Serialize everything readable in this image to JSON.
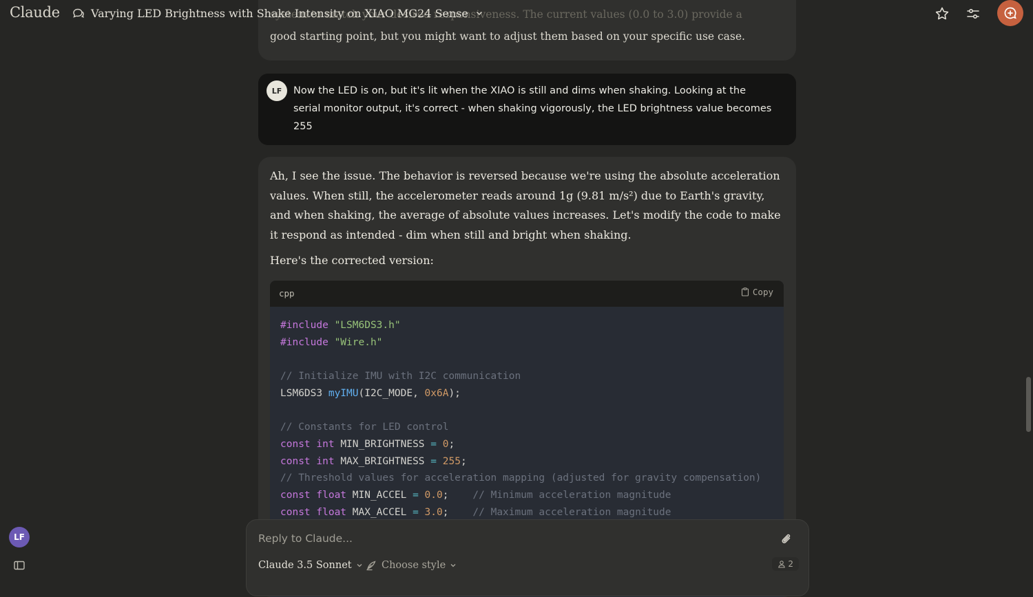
{
  "app": {
    "name": "Claude"
  },
  "header": {
    "conversation_title": "Varying LED Brightness with Shake Intensity on XIAO MG24 Sense",
    "icons": [
      "chat-bubble-icon",
      "chevron-down-icon",
      "star-icon",
      "sliders-icon",
      "new-chat-icon"
    ],
    "accent_color": "#c6613f"
  },
  "previous_message": {
    "faded_line": "system to match your desired responsiveness. The current values (0.0 to 3.0) provide a",
    "last_line": "good starting point, but you might want to adjust them based on your specific use case."
  },
  "user_message": {
    "avatar_initials": "LF",
    "text": "Now the LED is on, but it's lit when the XIAO is still and dims when shaking. Looking at the serial monitor output, it's correct - when shaking vigorously, the LED brightness value becomes 255"
  },
  "assistant_message": {
    "paragraph_1": "Ah, I see the issue. The behavior is reversed because we're using the absolute acceleration values. When still, the accelerometer reads around 1g (9.81 m/s²) due to Earth's gravity, and when shaking, the average of absolute values increases. Let's modify the code to make it respond as intended - dim when still and bright when shaking.",
    "paragraph_2": "Here's the corrected version:",
    "code_block": {
      "language": "cpp",
      "copy_label": "Copy",
      "lines": [
        [
          {
            "t": "kw",
            "v": "#include "
          },
          {
            "t": "str",
            "v": "\"LSM6DS3.h\""
          }
        ],
        [
          {
            "t": "kw",
            "v": "#include "
          },
          {
            "t": "str",
            "v": "\"Wire.h\""
          }
        ],
        [],
        [
          {
            "t": "com",
            "v": "// Initialize IMU with I2C communication"
          }
        ],
        [
          {
            "t": "plain",
            "v": "LSM6DS3 "
          },
          {
            "t": "fn",
            "v": "myIMU"
          },
          {
            "t": "plain",
            "v": "(I2C_MODE, "
          },
          {
            "t": "num",
            "v": "0x6A"
          },
          {
            "t": "plain",
            "v": ");"
          }
        ],
        [],
        [
          {
            "t": "com",
            "v": "// Constants for LED control"
          }
        ],
        [
          {
            "t": "kw",
            "v": "const int "
          },
          {
            "t": "plain",
            "v": "MIN_BRIGHTNESS "
          },
          {
            "t": "op",
            "v": "="
          },
          {
            "t": "plain",
            "v": " "
          },
          {
            "t": "num",
            "v": "0"
          },
          {
            "t": "plain",
            "v": ";"
          }
        ],
        [
          {
            "t": "kw",
            "v": "const int "
          },
          {
            "t": "plain",
            "v": "MAX_BRIGHTNESS "
          },
          {
            "t": "op",
            "v": "="
          },
          {
            "t": "plain",
            "v": " "
          },
          {
            "t": "num",
            "v": "255"
          },
          {
            "t": "plain",
            "v": ";"
          }
        ],
        [
          {
            "t": "com",
            "v": "// Threshold values for acceleration mapping (adjusted for gravity compensation)"
          }
        ],
        [
          {
            "t": "kw",
            "v": "const float "
          },
          {
            "t": "plain",
            "v": "MIN_ACCEL "
          },
          {
            "t": "op",
            "v": "="
          },
          {
            "t": "plain",
            "v": " "
          },
          {
            "t": "num",
            "v": "0.0"
          },
          {
            "t": "plain",
            "v": ";    "
          },
          {
            "t": "com",
            "v": "// Minimum acceleration magnitude"
          }
        ],
        [
          {
            "t": "kw",
            "v": "const float "
          },
          {
            "t": "plain",
            "v": "MAX_ACCEL "
          },
          {
            "t": "op",
            "v": "="
          },
          {
            "t": "plain",
            "v": " "
          },
          {
            "t": "num",
            "v": "3.0"
          },
          {
            "t": "plain",
            "v": ";    "
          },
          {
            "t": "com",
            "v": "// Maximum acceleration magnitude"
          }
        ]
      ]
    }
  },
  "composer": {
    "placeholder": "Reply to Claude...",
    "model_label": "Claude 3.5 Sonnet",
    "style_label": "Choose style",
    "count": "2"
  },
  "sidebar": {
    "user_initials": "LF"
  }
}
